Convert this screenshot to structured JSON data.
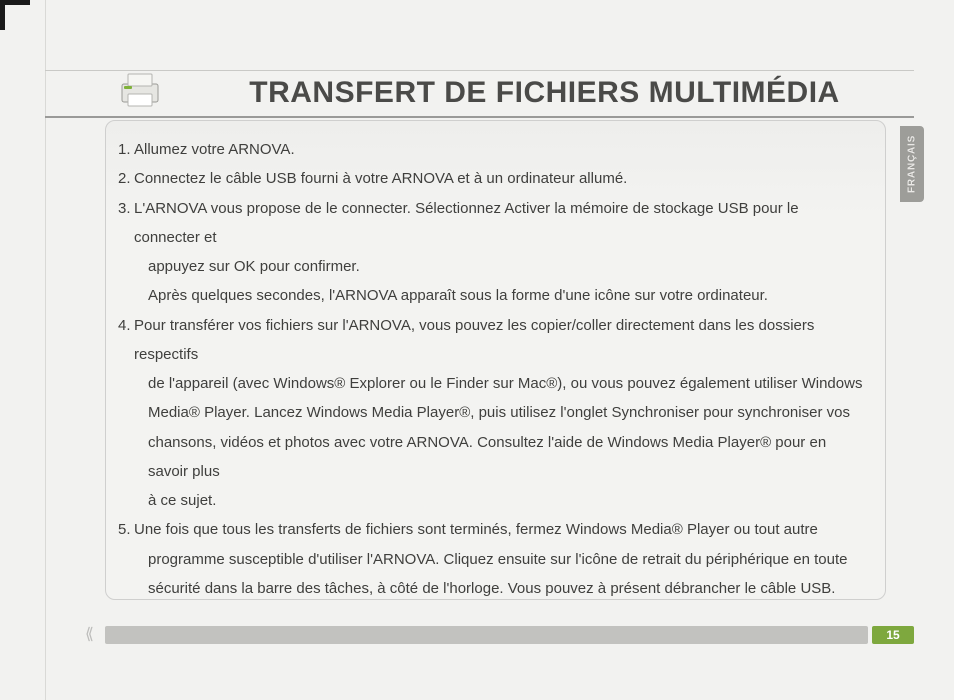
{
  "language_tab": "FRANÇAIS",
  "page_number": "15",
  "heading": "TRANSFERT DE FICHIERS MULTIMÉDIA",
  "steps": [
    {
      "n": "1.",
      "lines": [
        "Allumez votre ARNOVA."
      ]
    },
    {
      "n": "2.",
      "lines": [
        "Connectez le câble USB fourni à votre ARNOVA et à un ordinateur allumé."
      ]
    },
    {
      "n": "3.",
      "lines": [
        "L'ARNOVA vous propose de le connecter. Sélectionnez Activer la mémoire de stockage USB pour le connecter et",
        "appuyez sur OK pour confirmer.",
        "Après quelques secondes, l'ARNOVA apparaît sous la forme d'une icône sur votre ordinateur."
      ]
    },
    {
      "n": "4.",
      "lines": [
        "Pour transférer vos fichiers sur l'ARNOVA, vous pouvez les copier/coller directement dans les dossiers respectifs",
        "de l'appareil (avec Windows® Explorer ou le Finder sur Mac®), ou vous pouvez également utiliser Windows",
        "Media® Player. Lancez Windows Media Player®, puis utilisez l'onglet Synchroniser pour synchroniser vos",
        "chansons, vidéos et photos avec votre ARNOVA. Consultez l'aide de Windows Media Player® pour en savoir plus",
        "à ce sujet."
      ]
    },
    {
      "n": "5.",
      "lines": [
        "Une fois que tous les transferts de fichiers sont terminés, fermez Windows Media® Player ou tout autre",
        "programme susceptible d'utiliser l'ARNOVA. Cliquez ensuite sur l'icône de retrait du périphérique en toute",
        "sécurité dans la barre des tâches, à côté de l'horloge. Vous pouvez à présent débrancher le câble USB."
      ]
    }
  ],
  "icon_name": "printer-icon"
}
